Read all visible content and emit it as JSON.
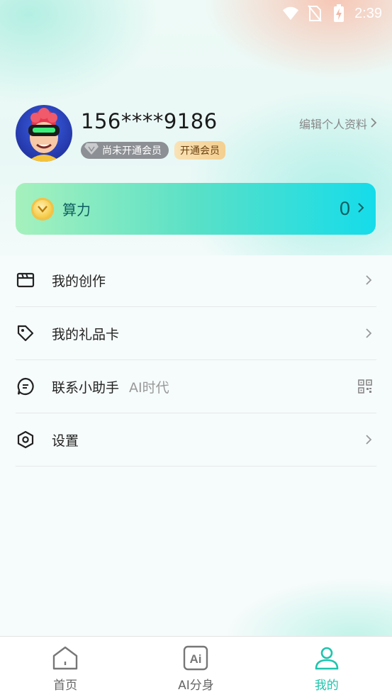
{
  "status_bar": {
    "time": "2:39",
    "wifi_icon": "wifi-icon",
    "sim_icon": "no-sim-icon",
    "battery_icon": "battery-charging-icon"
  },
  "profile": {
    "phone": "156****9186",
    "edit_label": "编辑个人资料",
    "member_status": "尚未开通会员",
    "open_member": "开通会员"
  },
  "compute": {
    "label": "算力",
    "value": "0"
  },
  "menu": [
    {
      "label": "我的创作",
      "icon": "clapperboard-icon",
      "right": "chevron-right-icon"
    },
    {
      "label": "我的礼品卡",
      "icon": "tag-icon",
      "right": "chevron-right-icon"
    },
    {
      "label": "联系小助手",
      "sub": "AI时代",
      "icon": "chat-bubble-icon",
      "right": "qr-code-icon"
    },
    {
      "label": "设置",
      "icon": "hexagon-settings-icon",
      "right": "chevron-right-icon"
    }
  ],
  "tabs": [
    {
      "label": "首页",
      "icon": "home-icon",
      "active": false
    },
    {
      "label": "AI分身",
      "icon": "ai-icon",
      "active": false
    },
    {
      "label": "我的",
      "icon": "user-icon",
      "active": true
    }
  ],
  "colors": {
    "accent": "#1ec4ad",
    "card_start": "#a6f1bd",
    "card_end": "#15dcea"
  }
}
